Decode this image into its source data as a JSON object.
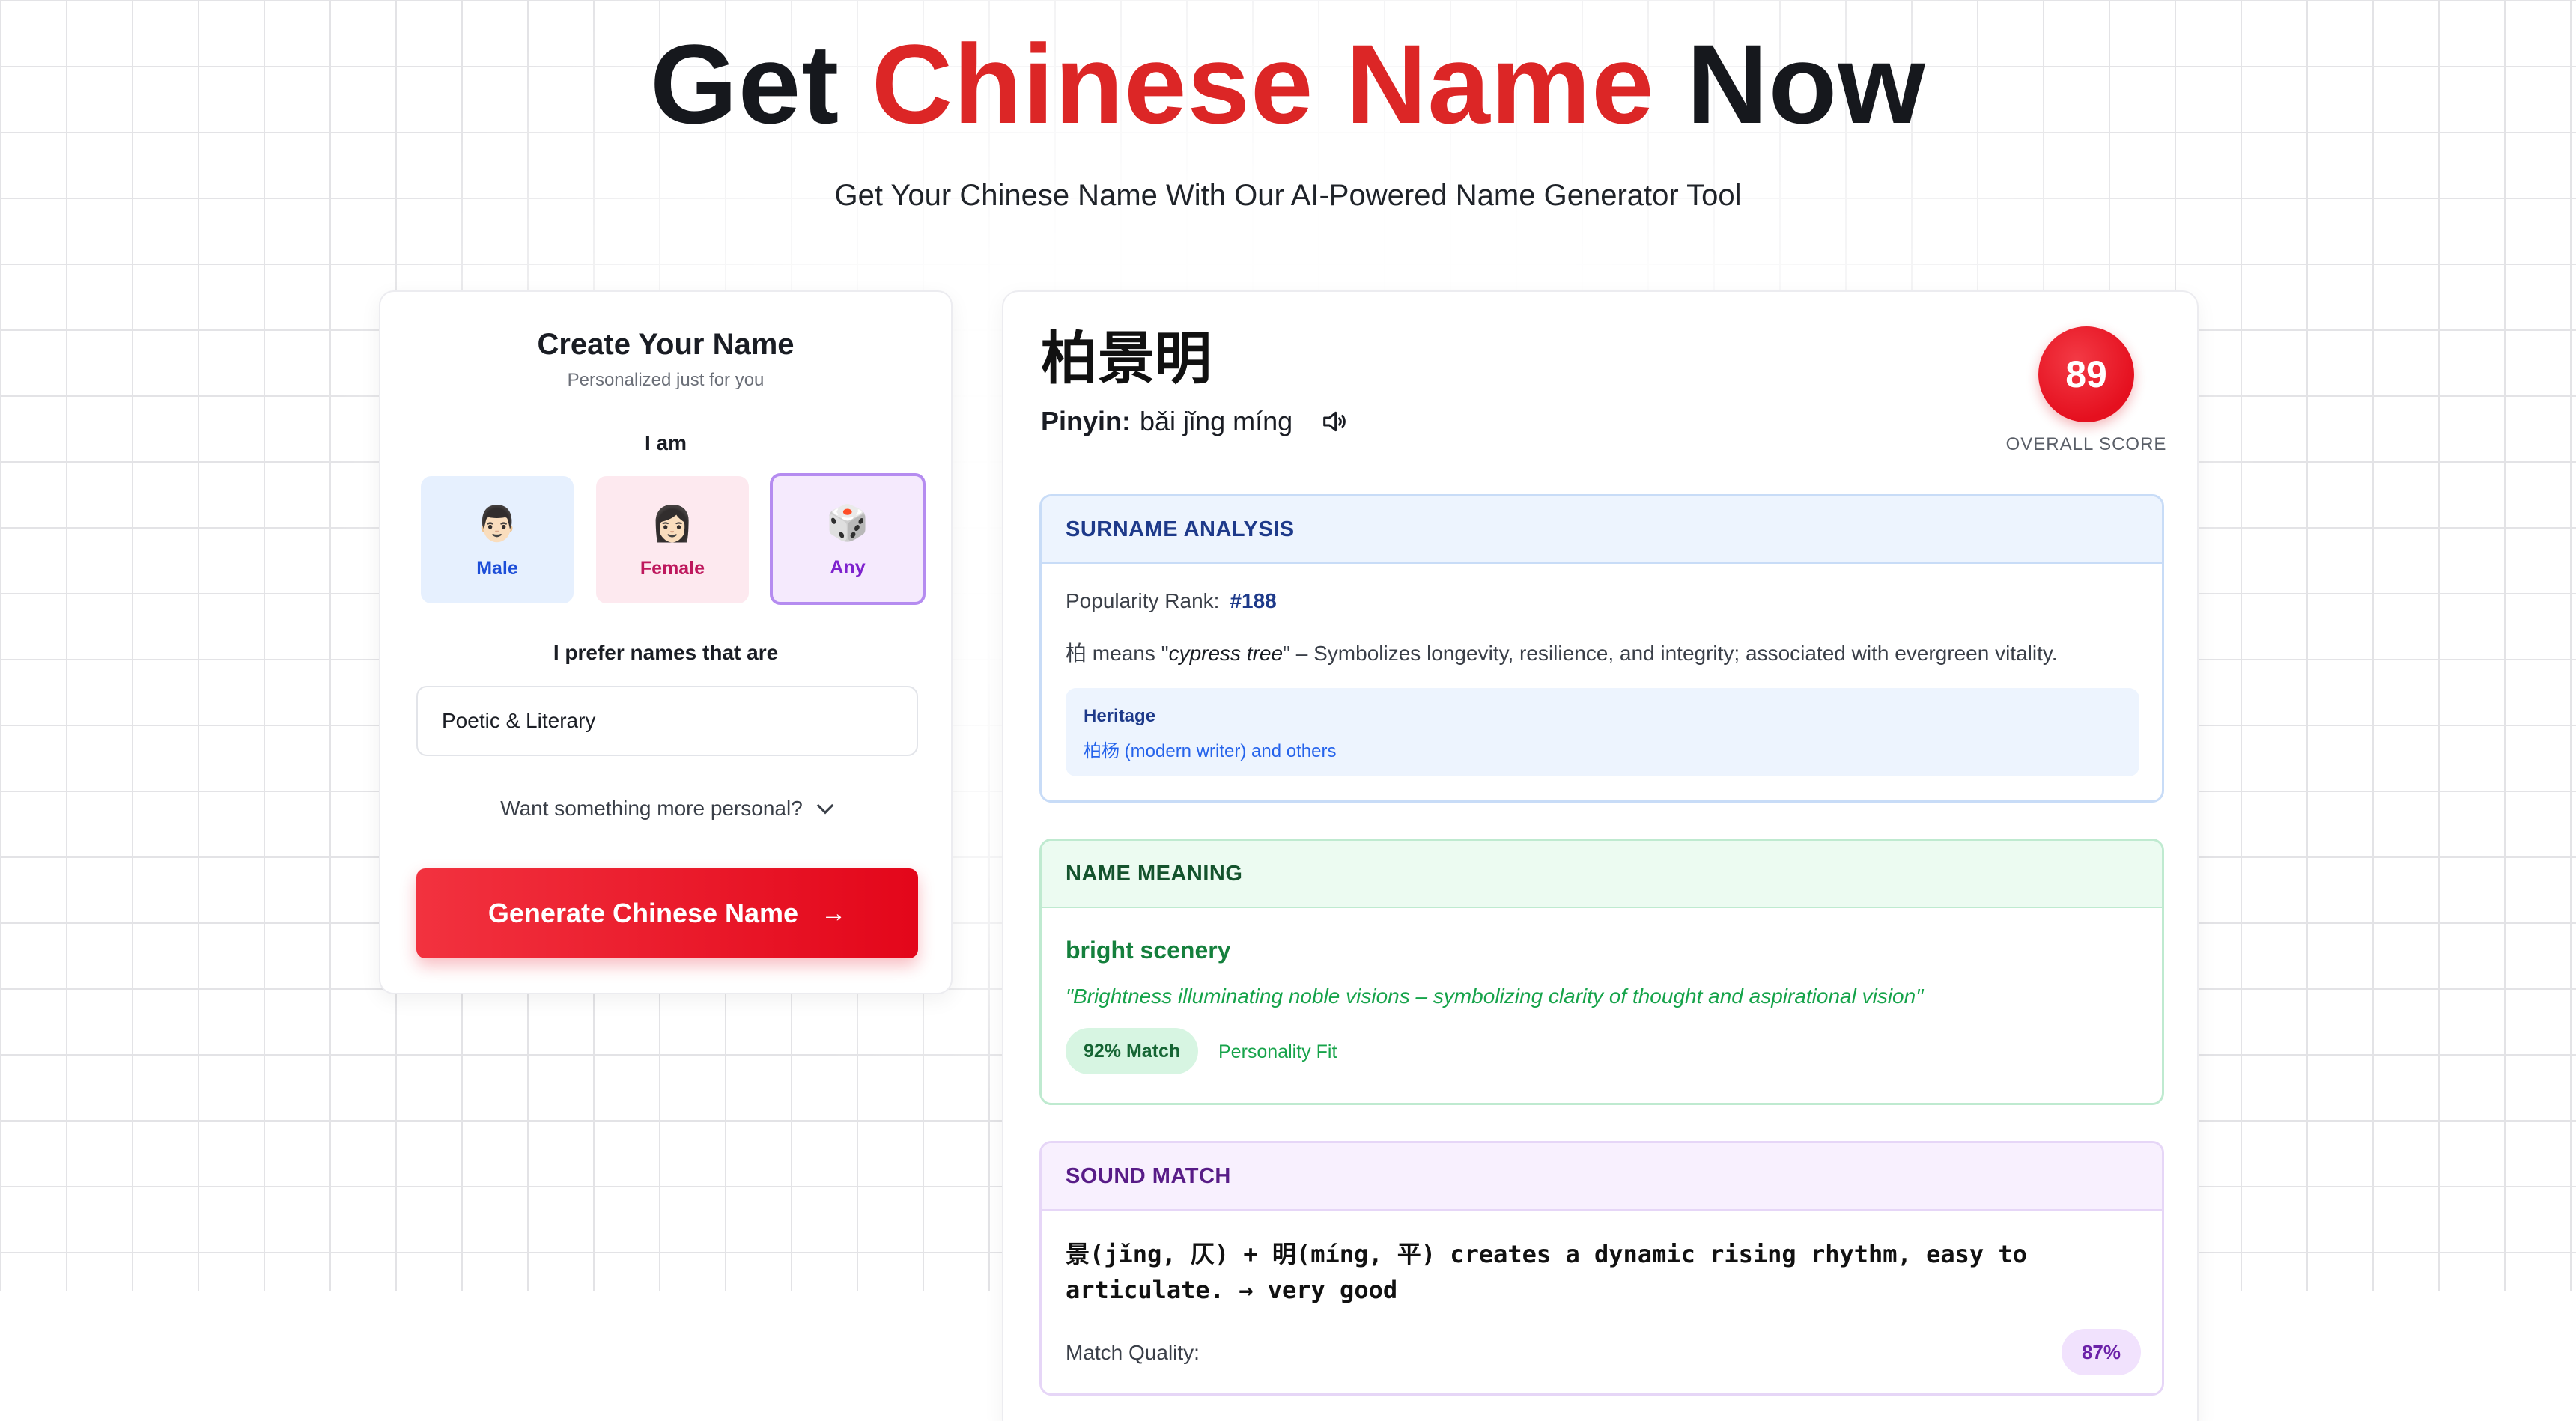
{
  "hero": {
    "title_start": "Get ",
    "title_accent": "Chinese Name",
    "title_end": " Now",
    "subtitle": "Get Your Chinese Name With Our AI-Powered Name Generator Tool"
  },
  "create": {
    "title": "Create Your Name",
    "subtitle": "Personalized just for you",
    "i_am_label": "I am",
    "genders": [
      {
        "label": "Male",
        "emoji": "👨🏻"
      },
      {
        "label": "Female",
        "emoji": "👩🏻"
      },
      {
        "label": "Any",
        "emoji": "🎲",
        "selected": true
      }
    ],
    "prefer_label": "I prefer names that are",
    "preference_value": "Poetic & Literary",
    "more_personal": "Want something more personal?",
    "generate_label": "Generate Chinese Name",
    "generate_arrow": "→"
  },
  "result": {
    "chinese_name": "柏景明",
    "pinyin_label": "Pinyin:",
    "pinyin": "bǎi jǐng míng",
    "score": "89",
    "score_label": "OVERALL SCORE",
    "surname": {
      "heading": "SURNAME ANALYSIS",
      "rank_label": "Popularity Rank:",
      "rank": "#188",
      "meaning_char": "柏",
      "meaning_pre": " means \"",
      "meaning_word": "cypress tree",
      "meaning_post": "\" – Symbolizes longevity, resilience, and integrity; associated with evergreen vitality.",
      "heritage_title": "Heritage",
      "heritage_value": "柏杨 (modern writer) and others"
    },
    "meaning": {
      "heading": "NAME MEANING",
      "title": "bright scenery",
      "quote": "\"Brightness illuminating noble visions – symbolizing clarity of thought and aspirational vision\"",
      "match": "92% Match",
      "fit_label": "Personality Fit"
    },
    "sound": {
      "heading": "SOUND MATCH",
      "description": "景(jǐng, 仄) + 明(míng, 平) creates a dynamic rising rhythm, easy to articulate. → very good",
      "quality_label": "Match Quality:",
      "quality": "87%"
    }
  },
  "colors": {
    "accent": "#dc2626",
    "button": "#e3061a",
    "selected_border": "#b58cf0"
  }
}
